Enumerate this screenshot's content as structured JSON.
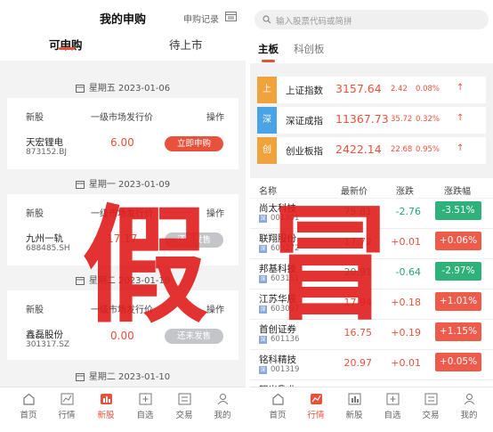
{
  "left": {
    "title": "我的申购",
    "record_label": "申购记录",
    "tabs": [
      {
        "label": "可申购"
      },
      {
        "label": "待上市"
      }
    ],
    "col_new": "新股",
    "col_price": "一级市场发行价",
    "col_action": "操作",
    "dates": [
      "星期五 2023-01-06",
      "星期一 2023-01-09",
      "星期二 2023-01-10",
      "星期二 2023-01-10"
    ],
    "stocks": [
      {
        "name": "天宏锂电",
        "code": "873152.BJ",
        "price": "6.00",
        "action": "立即申购"
      },
      {
        "name": "九州一轨",
        "code": "688485.SH",
        "price": "17.17",
        "action": "还未发售"
      },
      {
        "name": "鑫磊股份",
        "code": "301317.SZ",
        "price": "0.00",
        "action": "还未发售"
      }
    ],
    "tabbar": [
      {
        "label": "首页",
        "icon": "home-icon"
      },
      {
        "label": "行情",
        "icon": "chart-icon"
      },
      {
        "label": "新股",
        "icon": "ipo-icon"
      },
      {
        "label": "自选",
        "icon": "plus-icon"
      },
      {
        "label": "交易",
        "icon": "trade-icon"
      },
      {
        "label": "我的",
        "icon": "user-icon"
      }
    ]
  },
  "watermark": {
    "char1": "假",
    "char2": "冒"
  },
  "right": {
    "search_placeholder": "输入股票代码或简拼",
    "tabs": [
      {
        "label": "主板"
      },
      {
        "label": "科创板"
      }
    ],
    "indices": [
      {
        "badge": "上",
        "name": "上证指数",
        "value": "3157.64",
        "change": "2.42",
        "pct": "0.08%",
        "color": "#f0a33c"
      },
      {
        "badge": "深",
        "name": "深证成指",
        "value": "11367.73",
        "change": "35.72",
        "pct": "0.32%",
        "color": "#4aa3e6"
      },
      {
        "badge": "创",
        "name": "创业板指",
        "value": "2422.14",
        "change": "22.68",
        "pct": "0.95%",
        "color": "#f0a33c"
      }
    ],
    "headers": {
      "name": "名称",
      "price": "最新价",
      "change": "涨跌",
      "pct": "涨跌幅"
    },
    "quotes": [
      {
        "name": "尚太科技",
        "code": "001301",
        "price": "75.81",
        "change": "-2.76",
        "pct": "-3.51%",
        "dir": "down"
      },
      {
        "name": "联翔股份",
        "code": "603272",
        "price": "17.72",
        "change": "+0.01",
        "pct": "+0.06%",
        "dir": "up"
      },
      {
        "name": "邦基科技",
        "code": "603151",
        "price": "20.91",
        "change": "-0.64",
        "pct": "-2.97%",
        "dir": "down"
      },
      {
        "name": "江苏华辰",
        "code": "603097",
        "price": "17.94",
        "change": "+0.18",
        "pct": "+1.01%",
        "dir": "up"
      },
      {
        "name": "首创证券",
        "code": "601136",
        "price": "16.75",
        "change": "+0.19",
        "pct": "+1.15%",
        "dir": "up"
      },
      {
        "name": "铭科精技",
        "code": "001319",
        "price": "20.97",
        "change": "+0.01",
        "pct": "+0.05%",
        "dir": "up"
      },
      {
        "name": "阳光乳业",
        "code": "",
        "price": "",
        "change": "",
        "pct": "",
        "dir": "up"
      }
    ],
    "tabbar": [
      {
        "label": "首页",
        "icon": "home-icon"
      },
      {
        "label": "行情",
        "icon": "chart-icon"
      },
      {
        "label": "新股",
        "icon": "ipo-icon"
      },
      {
        "label": "自选",
        "icon": "plus-icon"
      },
      {
        "label": "交易",
        "icon": "trade-icon"
      },
      {
        "label": "我的",
        "icon": "user-icon"
      }
    ]
  }
}
